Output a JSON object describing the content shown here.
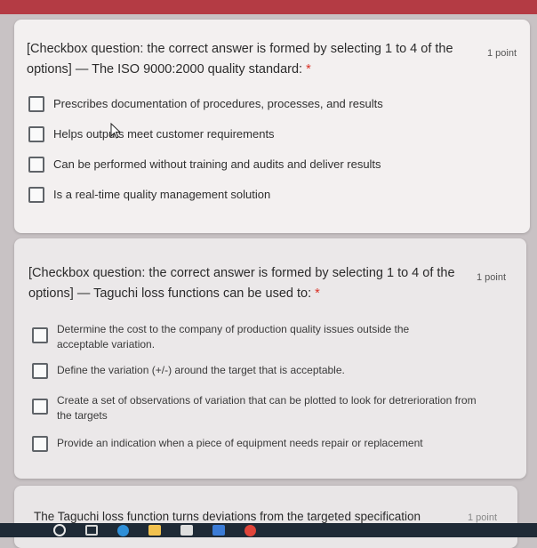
{
  "questions": [
    {
      "text": "[Checkbox question: the correct answer is formed by selecting 1 to 4 of the options] — The ISO 9000:2000 quality standard:",
      "required_marker": "*",
      "points": "1 point",
      "options": [
        "Prescribes documentation of procedures, processes, and results",
        "Helps outputs meet customer requirements",
        "Can be performed without training and audits and deliver results",
        "Is a real-time quality management solution"
      ]
    },
    {
      "text": "[Checkbox question: the correct answer is formed by selecting 1 to 4 of the options] — Taguchi loss functions can be used to:",
      "required_marker": "*",
      "points": "1 point",
      "options": [
        "Determine the cost to the company of production quality issues outside the acceptable variation.",
        "Define the variation (+/-) around the target that is acceptable.",
        "Create a set of observations of variation that can be plotted to look for detrerioration from the targets",
        "Provide an indication when a piece of equipment needs repair or replacement"
      ]
    },
    {
      "text": "The Taguchi loss function turns deviations from the targeted specification",
      "points": "1 point"
    }
  ],
  "taskbar": {
    "icons": [
      "search-icon",
      "task-view-icon",
      "edge-browser-icon",
      "file-explorer-icon",
      "store-icon",
      "mail-icon",
      "chrome-icon"
    ]
  },
  "colors": {
    "required": "#d93025",
    "header_strip": "#b43b44"
  }
}
